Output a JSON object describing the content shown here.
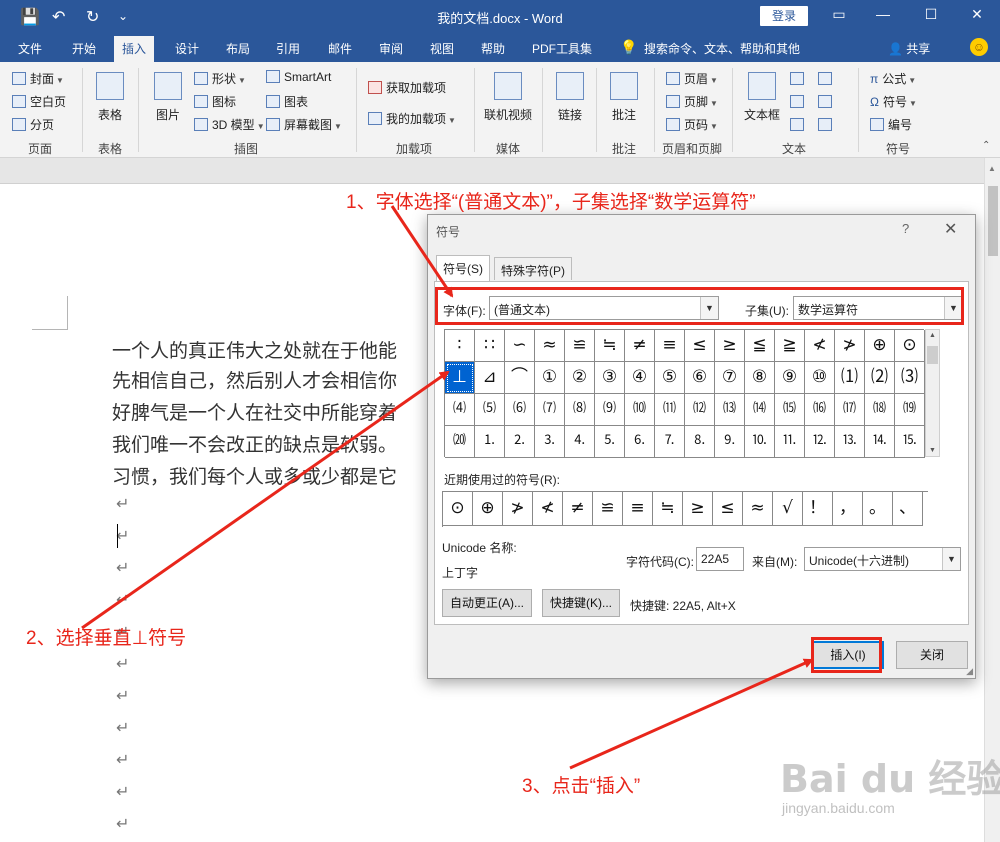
{
  "titlebar": {
    "title": "我的文档.docx  -  Word",
    "login": "登录",
    "qa_save": "💾",
    "qa_undo": "↶",
    "qa_redo": "↻",
    "qa_more": "⌄",
    "ctl_ribbon": "▭",
    "ctl_min": "—",
    "ctl_max": "☐",
    "ctl_close": "✕"
  },
  "tabs": {
    "items": [
      "文件",
      "开始",
      "插入",
      "设计",
      "布局",
      "引用",
      "邮件",
      "审阅",
      "视图",
      "帮助",
      "PDF工具集"
    ],
    "active": "插入",
    "tellme_icon": "💡",
    "tellme": "搜索命令、文本、帮助和其他",
    "share": "共享",
    "share_icon": "👤",
    "smiley": "☺"
  },
  "ribbon": {
    "pages": {
      "cover": "封面",
      "blank": "空白页",
      "break": "分页",
      "label": "页面"
    },
    "tables": {
      "table": "表格",
      "label": "表格"
    },
    "illustrations": {
      "pictures": "图片",
      "shapes": "形状",
      "icons": "图标",
      "model3d": "3D 模型",
      "smartart": "SmartArt",
      "chart": "图表",
      "screenshot": "屏幕截图",
      "label": "插图"
    },
    "addins": {
      "get": "获取加载项",
      "mine": "我的加载项",
      "label": "加载项"
    },
    "media": {
      "video": "联机视频",
      "label": "媒体"
    },
    "links": {
      "link": "链接"
    },
    "comments": {
      "comment": "批注",
      "label": "批注"
    },
    "header_footer": {
      "header": "页眉",
      "footer": "页脚",
      "page_number": "页码",
      "label": "页眉和页脚"
    },
    "text": {
      "textbox": "文本框",
      "label": "文本"
    },
    "symbols": {
      "equation": "公式",
      "symbol": "符号",
      "numbering": "编号",
      "label": "符号"
    }
  },
  "document": {
    "lines": [
      "一个人的真正伟大之处就在于他能",
      "先相信自己，然后别人才会相信你",
      "好脾气是一个人在社交中所能穿着",
      "我们唯一不会改正的缺点是软弱。",
      "习惯，我们每个人或多或少都是它"
    ],
    "para_mark": "↵"
  },
  "dialog": {
    "title": "符号",
    "help": "?",
    "close": "✕",
    "tab_symbols": "符号(S)",
    "tab_special": "特殊字符(P)",
    "font_label": "字体(F):",
    "font_value": "(普通文本)",
    "subset_label": "子集(U):",
    "subset_value": "数学运算符",
    "grid": [
      [
        "∶",
        "∷",
        "∽",
        "≈",
        "≌",
        "≒",
        "≠",
        "≡",
        "≤",
        "≥",
        "≦",
        "≧",
        "≮",
        "≯",
        "⊕",
        "⊙"
      ],
      [
        "⊥",
        "⊿",
        "⌒",
        "①",
        "②",
        "③",
        "④",
        "⑤",
        "⑥",
        "⑦",
        "⑧",
        "⑨",
        "⑩",
        "⑴",
        "⑵",
        "⑶"
      ],
      [
        "⑷",
        "⑸",
        "⑹",
        "⑺",
        "⑻",
        "⑼",
        "⑽",
        "⑾",
        "⑿",
        "⒀",
        "⒁",
        "⒂",
        "⒃",
        "⒄",
        "⒅",
        "⒆"
      ],
      [
        "⒇",
        "⒈",
        "⒉",
        "⒊",
        "⒋",
        "⒌",
        "⒍",
        "⒎",
        "⒏",
        "⒐",
        "⒑",
        "⒒",
        "⒓",
        "⒔",
        "⒕",
        "⒖"
      ]
    ],
    "selected": "⊥",
    "recent_label": "近期使用过的符号(R):",
    "recent": [
      "⊙",
      "⊕",
      "≯",
      "≮",
      "≠",
      "≌",
      "≡",
      "≒",
      "≥",
      "≤",
      "≈",
      "√",
      "！",
      "，",
      "。",
      "、"
    ],
    "unicode_name_label": "Unicode 名称:",
    "unicode_name": "上丁字",
    "char_code_label": "字符代码(C):",
    "char_code": "22A5",
    "from_label": "来自(M):",
    "from_value": "Unicode(十六进制)",
    "autocorrect_btn": "自动更正(A)...",
    "shortcut_btn": "快捷键(K)...",
    "shortcut_text": "快捷键: 22A5, Alt+X",
    "insert_btn": "插入(I)",
    "close_btn": "关闭"
  },
  "annotations": {
    "step1": "1、字体选择“(普通文本)”，子集选择“数学运算符”",
    "step2": "2、选择垂直⊥符号",
    "step3": "3、点击“插入”",
    "color": "#e8261b"
  },
  "watermark": {
    "main": "Bai du 经验",
    "sub": "jingyan.baidu.com"
  }
}
